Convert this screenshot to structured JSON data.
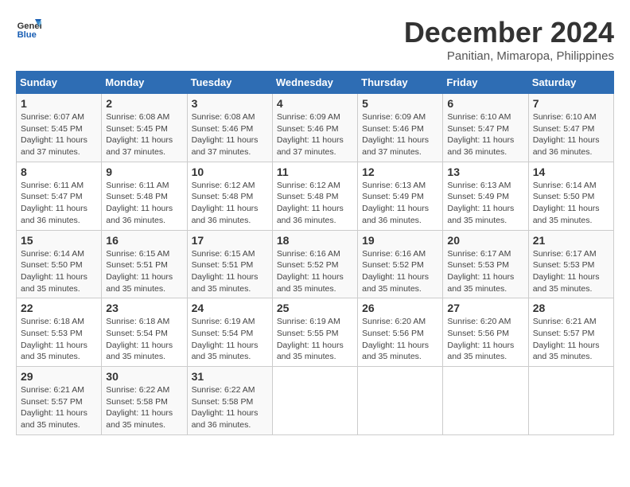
{
  "logo": {
    "line1": "General",
    "line2": "Blue"
  },
  "title": "December 2024",
  "subtitle": "Panitian, Mimaropa, Philippines",
  "headers": [
    "Sunday",
    "Monday",
    "Tuesday",
    "Wednesday",
    "Thursday",
    "Friday",
    "Saturday"
  ],
  "weeks": [
    [
      {
        "day": "1",
        "sunrise": "6:07 AM",
        "sunset": "5:45 PM",
        "daylight": "11 hours and 37 minutes."
      },
      {
        "day": "2",
        "sunrise": "6:08 AM",
        "sunset": "5:45 PM",
        "daylight": "11 hours and 37 minutes."
      },
      {
        "day": "3",
        "sunrise": "6:08 AM",
        "sunset": "5:46 PM",
        "daylight": "11 hours and 37 minutes."
      },
      {
        "day": "4",
        "sunrise": "6:09 AM",
        "sunset": "5:46 PM",
        "daylight": "11 hours and 37 minutes."
      },
      {
        "day": "5",
        "sunrise": "6:09 AM",
        "sunset": "5:46 PM",
        "daylight": "11 hours and 37 minutes."
      },
      {
        "day": "6",
        "sunrise": "6:10 AM",
        "sunset": "5:47 PM",
        "daylight": "11 hours and 36 minutes."
      },
      {
        "day": "7",
        "sunrise": "6:10 AM",
        "sunset": "5:47 PM",
        "daylight": "11 hours and 36 minutes."
      }
    ],
    [
      {
        "day": "8",
        "sunrise": "6:11 AM",
        "sunset": "5:47 PM",
        "daylight": "11 hours and 36 minutes."
      },
      {
        "day": "9",
        "sunrise": "6:11 AM",
        "sunset": "5:48 PM",
        "daylight": "11 hours and 36 minutes."
      },
      {
        "day": "10",
        "sunrise": "6:12 AM",
        "sunset": "5:48 PM",
        "daylight": "11 hours and 36 minutes."
      },
      {
        "day": "11",
        "sunrise": "6:12 AM",
        "sunset": "5:48 PM",
        "daylight": "11 hours and 36 minutes."
      },
      {
        "day": "12",
        "sunrise": "6:13 AM",
        "sunset": "5:49 PM",
        "daylight": "11 hours and 36 minutes."
      },
      {
        "day": "13",
        "sunrise": "6:13 AM",
        "sunset": "5:49 PM",
        "daylight": "11 hours and 35 minutes."
      },
      {
        "day": "14",
        "sunrise": "6:14 AM",
        "sunset": "5:50 PM",
        "daylight": "11 hours and 35 minutes."
      }
    ],
    [
      {
        "day": "15",
        "sunrise": "6:14 AM",
        "sunset": "5:50 PM",
        "daylight": "11 hours and 35 minutes."
      },
      {
        "day": "16",
        "sunrise": "6:15 AM",
        "sunset": "5:51 PM",
        "daylight": "11 hours and 35 minutes."
      },
      {
        "day": "17",
        "sunrise": "6:15 AM",
        "sunset": "5:51 PM",
        "daylight": "11 hours and 35 minutes."
      },
      {
        "day": "18",
        "sunrise": "6:16 AM",
        "sunset": "5:52 PM",
        "daylight": "11 hours and 35 minutes."
      },
      {
        "day": "19",
        "sunrise": "6:16 AM",
        "sunset": "5:52 PM",
        "daylight": "11 hours and 35 minutes."
      },
      {
        "day": "20",
        "sunrise": "6:17 AM",
        "sunset": "5:53 PM",
        "daylight": "11 hours and 35 minutes."
      },
      {
        "day": "21",
        "sunrise": "6:17 AM",
        "sunset": "5:53 PM",
        "daylight": "11 hours and 35 minutes."
      }
    ],
    [
      {
        "day": "22",
        "sunrise": "6:18 AM",
        "sunset": "5:53 PM",
        "daylight": "11 hours and 35 minutes."
      },
      {
        "day": "23",
        "sunrise": "6:18 AM",
        "sunset": "5:54 PM",
        "daylight": "11 hours and 35 minutes."
      },
      {
        "day": "24",
        "sunrise": "6:19 AM",
        "sunset": "5:54 PM",
        "daylight": "11 hours and 35 minutes."
      },
      {
        "day": "25",
        "sunrise": "6:19 AM",
        "sunset": "5:55 PM",
        "daylight": "11 hours and 35 minutes."
      },
      {
        "day": "26",
        "sunrise": "6:20 AM",
        "sunset": "5:56 PM",
        "daylight": "11 hours and 35 minutes."
      },
      {
        "day": "27",
        "sunrise": "6:20 AM",
        "sunset": "5:56 PM",
        "daylight": "11 hours and 35 minutes."
      },
      {
        "day": "28",
        "sunrise": "6:21 AM",
        "sunset": "5:57 PM",
        "daylight": "11 hours and 35 minutes."
      }
    ],
    [
      {
        "day": "29",
        "sunrise": "6:21 AM",
        "sunset": "5:57 PM",
        "daylight": "11 hours and 35 minutes."
      },
      {
        "day": "30",
        "sunrise": "6:22 AM",
        "sunset": "5:58 PM",
        "daylight": "11 hours and 35 minutes."
      },
      {
        "day": "31",
        "sunrise": "6:22 AM",
        "sunset": "5:58 PM",
        "daylight": "11 hours and 36 minutes."
      },
      null,
      null,
      null,
      null
    ]
  ],
  "labels": {
    "sunrise": "Sunrise: ",
    "sunset": "Sunset: ",
    "daylight": "Daylight: "
  }
}
